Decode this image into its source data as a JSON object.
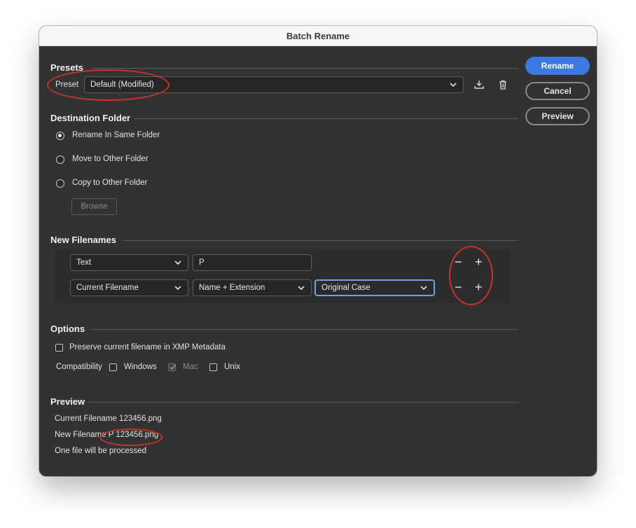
{
  "window": {
    "title": "Batch Rename"
  },
  "buttons": {
    "rename": "Rename",
    "cancel": "Cancel",
    "preview": "Preview"
  },
  "presets": {
    "heading": "Presets",
    "label": "Preset",
    "value": "Default (Modified)",
    "save_icon": "save-preset-icon",
    "delete_icon": "trash-icon"
  },
  "destination": {
    "heading": "Destination Folder",
    "options": [
      "Rename In Same Folder",
      "Move to Other Folder",
      "Copy to Other Folder"
    ],
    "selected": "Rename In Same Folder",
    "browse": "Browse"
  },
  "new_filenames": {
    "heading": "New Filenames",
    "rows": [
      {
        "type": "Text",
        "value": "P"
      },
      {
        "type": "Current Filename",
        "option": "Name + Extension",
        "case": "Original Case"
      }
    ],
    "minus": "−",
    "plus": "+"
  },
  "options": {
    "heading": "Options",
    "preserve_label": "Preserve current filename in XMP Metadata",
    "preserve_checked": false,
    "compat_label": "Compatibility",
    "windows": "Windows",
    "mac": "Mac",
    "unix": "Unix"
  },
  "preview": {
    "heading": "Preview",
    "current": "Current Filename 123456.png",
    "new": "New Filename P 123456.png",
    "count": "One file will be processed"
  },
  "colors": {
    "accent": "#3d78e0",
    "annotation": "#c9322a",
    "panel": "#323232"
  }
}
